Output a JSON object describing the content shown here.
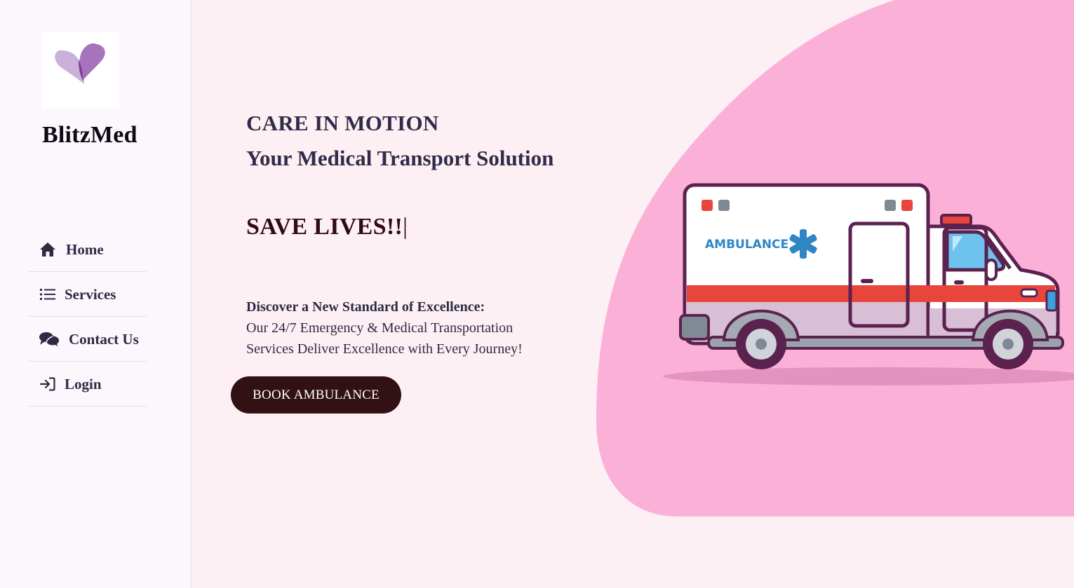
{
  "brand": {
    "name": "BlitzMed",
    "logo_icon": "heart-logo-icon"
  },
  "nav": {
    "items": [
      {
        "label": "Home",
        "icon": "home-icon"
      },
      {
        "label": "Services",
        "icon": "list-icon"
      },
      {
        "label": "Contact Us",
        "icon": "chat-icon"
      },
      {
        "label": "Login",
        "icon": "login-icon"
      }
    ]
  },
  "hero": {
    "headline_line1": "CARE IN MOTION",
    "headline_line2": "Your Medical Transport Solution",
    "typing_text": "SAVE LIVES!!",
    "typing_cursor": "|",
    "desc_lead": "Discover a New Standard of Excellence:",
    "desc_body": "Our 24/7 Emergency & Medical Transportation Services Deliver Excellence with Every Journey!",
    "cta_label": "BOOK AMBULANCE"
  },
  "illustration": {
    "vehicle_text": "AMBULANCE",
    "icon": "ambulance-illustration"
  },
  "colors": {
    "page_bg": "#fdf0f4",
    "sidebar_bg": "#fbf7fc",
    "blob": "#fbb0d8",
    "heading": "#312b4a",
    "accent_dark": "#321114"
  }
}
